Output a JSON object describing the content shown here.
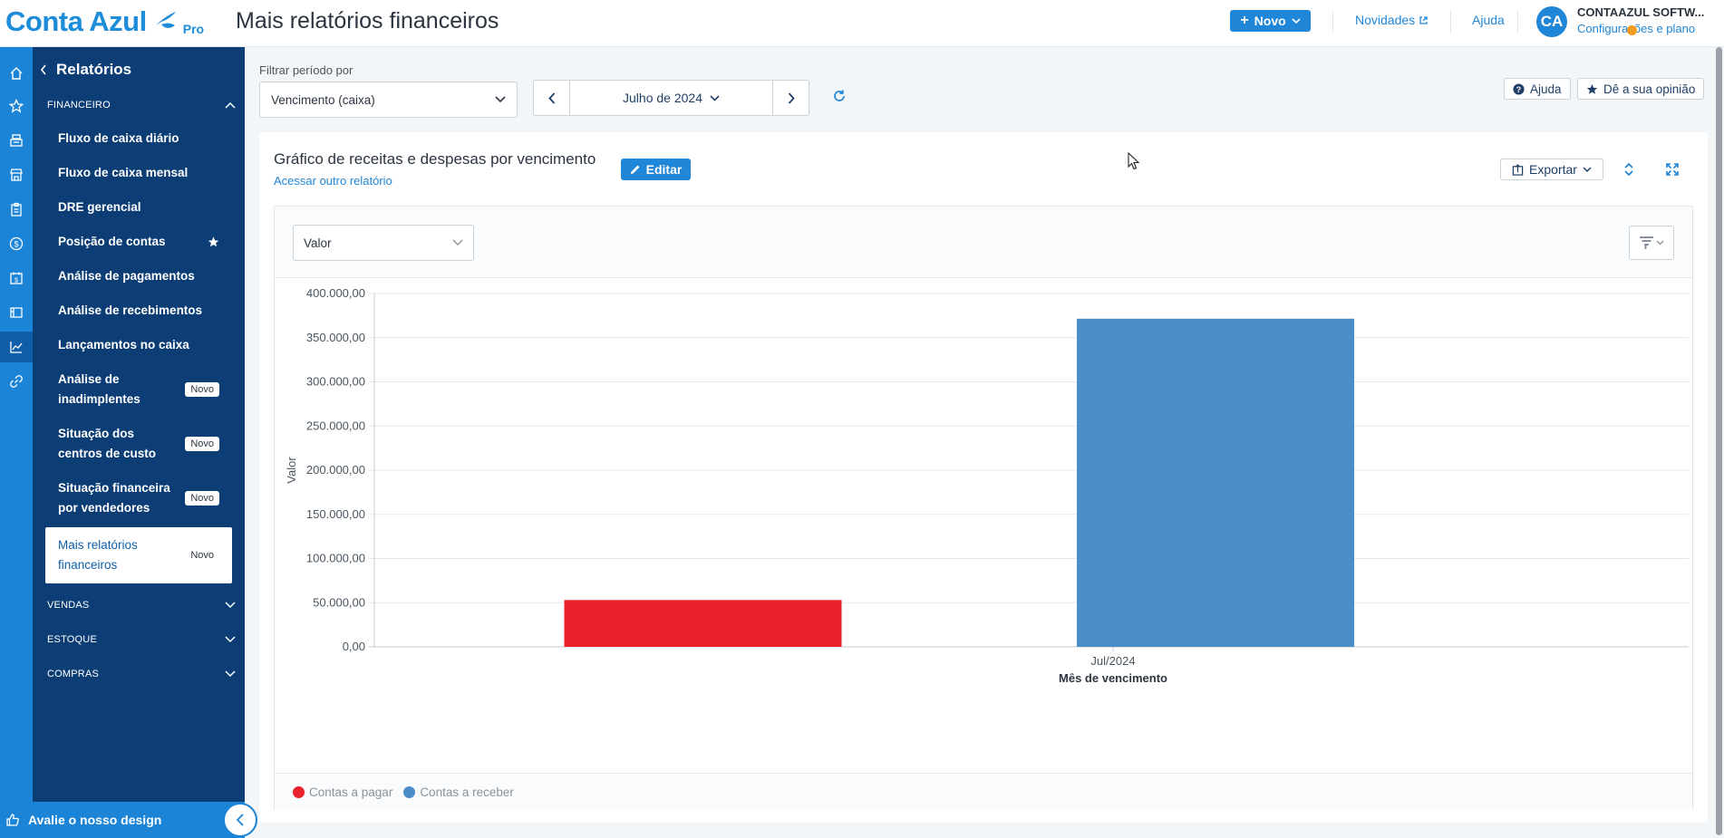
{
  "header": {
    "brand": "Conta Azul",
    "brand_tier": "Pro",
    "page_title": "Mais relatórios financeiros",
    "new_button": "Novo",
    "news_link": "Novidades",
    "help_link": "Ajuda",
    "avatar_initials": "CA",
    "company_name": "CONTAAZUL SOFTW...",
    "company_sub": "Configurações e plano"
  },
  "rail": {
    "icons": [
      "home-icon",
      "star-icon",
      "register-icon",
      "store-icon",
      "clipboard-icon",
      "dollar-icon",
      "calendar-money-icon",
      "receipt-icon",
      "chart-line-icon",
      "link-icon"
    ],
    "active_icon": "chart-line-icon"
  },
  "sidebar": {
    "title": "Relatórios",
    "section_financeiro": "FINANCEIRO",
    "items": [
      {
        "label": "Fluxo de caixa diário"
      },
      {
        "label": "Fluxo de caixa mensal"
      },
      {
        "label": "DRE gerencial"
      },
      {
        "label": "Posição de contas"
      },
      {
        "label": "Análise de pagamentos"
      },
      {
        "label": "Análise de recebimentos"
      },
      {
        "label": "Lançamentos no caixa"
      },
      {
        "label": "Análise de inadimplentes",
        "badge": "Novo"
      },
      {
        "label": "Situação dos centros de custo",
        "badge": "Novo"
      },
      {
        "label": "Situação financeira por vendedores",
        "badge": "Novo"
      },
      {
        "label": "Mais relatórios financeiros",
        "badge": "Novo"
      }
    ],
    "section_vendas": "VENDAS",
    "section_estoque": "ESTOQUE",
    "section_compras": "COMPRAS",
    "footer": "Avalie o nosso design"
  },
  "filters": {
    "label": "Filtrar período por",
    "period_value": "Vencimento (caixa)",
    "month": "Julho de 2024",
    "help_button": "Ajuda",
    "feedback_button": "Dê a sua opinião"
  },
  "report": {
    "title": "Gráfico de receitas e despesas por vencimento",
    "other_report_link": "Acessar outro relatório",
    "edit_button": "Editar",
    "export_button": "Exportar",
    "metric_select": "Valor"
  },
  "chart_data": {
    "type": "bar",
    "categories": [
      "Jul/2024"
    ],
    "series": [
      {
        "name": "Contas a pagar",
        "values": [
          53000
        ],
        "color": "#e8212b"
      },
      {
        "name": "Contas a receber",
        "values": [
          371500
        ],
        "color": "#4a8dc9"
      }
    ],
    "xlabel": "Mês de vencimento",
    "ylabel": "Valor",
    "ylim": [
      0,
      400000
    ],
    "yticks": [
      "0,00",
      "50.000,00",
      "100.000,00",
      "150.000,00",
      "200.000,00",
      "250.000,00",
      "300.000,00",
      "350.000,00",
      "400.000,00"
    ],
    "grid": true,
    "legend_position": "bottom-left"
  }
}
